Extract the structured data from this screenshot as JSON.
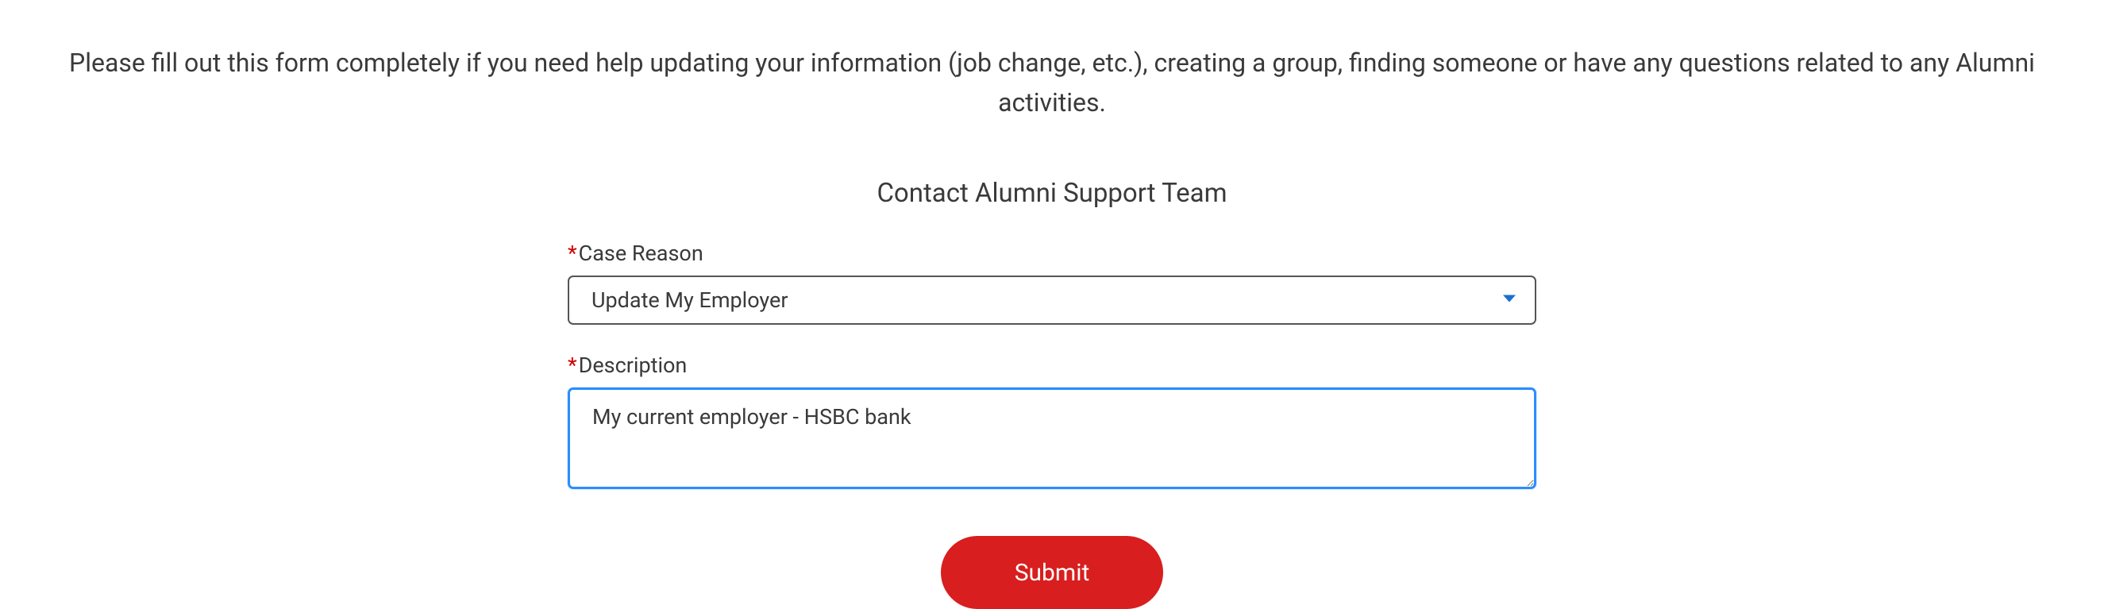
{
  "intro": "Please fill out this form completely if you need help updating your information (job change, etc.), creating a group, finding someone or have any questions related to any Alumni activities.",
  "form_title": "Contact Alumni Support Team",
  "fields": {
    "case_reason": {
      "label": "Case Reason",
      "value": "Update My Employer"
    },
    "description": {
      "label": "Description",
      "value": "My current employer - HSBC bank"
    }
  },
  "submit_label": "Submit"
}
